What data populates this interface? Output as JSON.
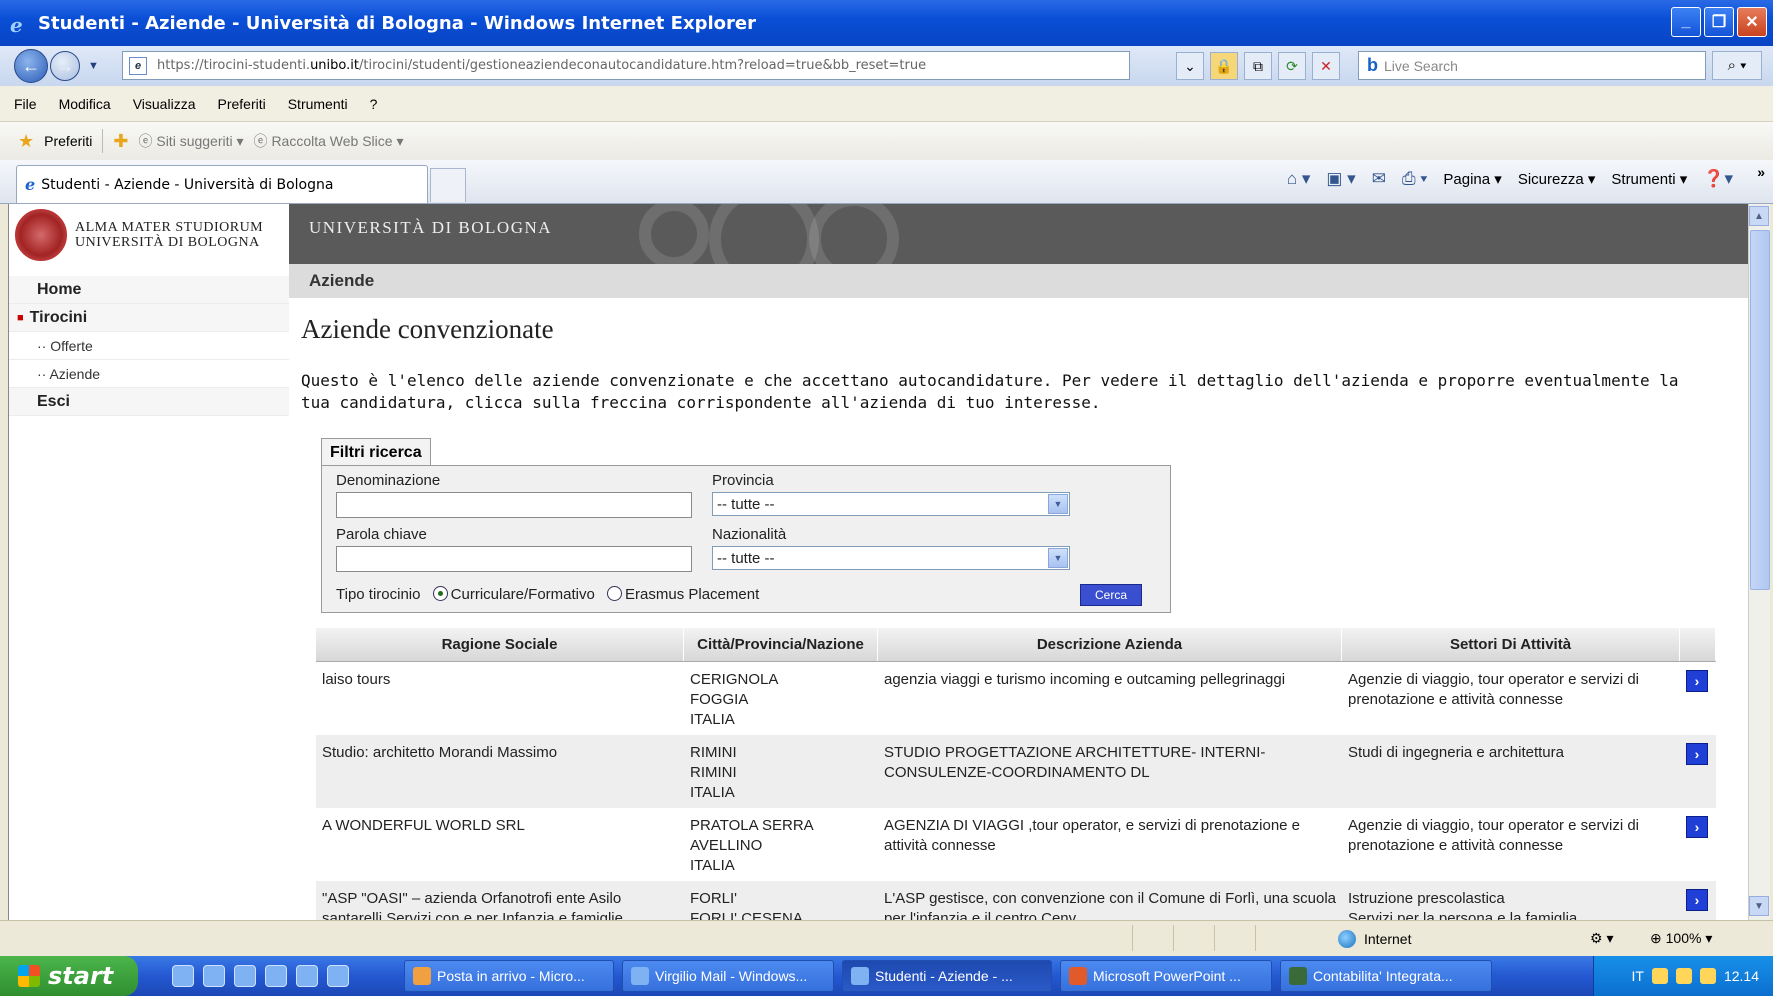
{
  "window": {
    "title": "Studenti - Aziende - Università di Bologna - Windows Internet Explorer"
  },
  "address": {
    "url_prefix": "https://tirocini-studenti.",
    "url_domain": "unibo.it",
    "url_path": "/tirocini/studenti/gestioneaziendeconautocandidature.htm?reload=true&bb_reset=true",
    "search_placeholder": "Live Search"
  },
  "menu": [
    "File",
    "Modifica",
    "Visualizza",
    "Preferiti",
    "Strumenti",
    "?"
  ],
  "favorites": {
    "label": "Preferiti",
    "suggested": "Siti suggeriti",
    "webslice": "Raccolta Web Slice"
  },
  "tab": {
    "title": "Studenti - Aziende - Università di Bologna"
  },
  "commandbar": {
    "pagina": "Pagina",
    "sicurezza": "Sicurezza",
    "strumenti": "Strumenti"
  },
  "site": {
    "logo_line1": "ALMA MATER STUDIORUM",
    "logo_line2": "UNIVERSITÀ DI BOLOGNA",
    "banner_title": "UNIVERSITÀ DI BOLOGNA",
    "section": "Aziende"
  },
  "sidenav": {
    "home": "Home",
    "tirocini": "Tirocini",
    "offerte": "·· Offerte",
    "aziende": "·· Aziende",
    "esci": "Esci"
  },
  "page": {
    "title": "Aziende convenzionate",
    "intro": "Questo è l'elenco delle aziende convenzionate e che accettano autocandidature. Per vedere il dettaglio dell'azienda e proporre eventualmente la tua candidatura, clicca sulla freccina corrispondente all'azienda di tuo interesse."
  },
  "filters": {
    "title": "Filtri ricerca",
    "denominazione_label": "Denominazione",
    "provincia_label": "Provincia",
    "provincia_value": "-- tutte --",
    "parola_label": "Parola chiave",
    "nazionalita_label": "Nazionalità",
    "nazionalita_value": "-- tutte --",
    "tipo_label": "Tipo tirocinio",
    "opt1": "Curriculare/Formativo",
    "opt2": "Erasmus Placement",
    "cerca": "Cerca"
  },
  "table": {
    "headers": [
      "Ragione Sociale",
      "Città/Provincia/Nazione",
      "Descrizione Azienda",
      "Settori Di Attività"
    ],
    "rows": [
      {
        "ragione": "laiso tours",
        "city": "CERIGNOLA",
        "prov": "FOGGIA",
        "naz": "ITALIA",
        "desc": "agenzia viaggi e turismo incoming e outcaming pellegrinaggi",
        "settori": "Agenzie di viaggio, tour operator e servizi di prenotazione e attività connesse"
      },
      {
        "ragione": "Studio: architetto Morandi Massimo",
        "city": "RIMINI",
        "prov": "RIMINI",
        "naz": "ITALIA",
        "desc": "STUDIO PROGETTAZIONE ARCHITETTURE- INTERNI-CONSULENZE-COORDINAMENTO DL",
        "settori": "Studi di ingegneria e architettura"
      },
      {
        "ragione": "A WONDERFUL WORLD SRL",
        "city": "PRATOLA SERRA",
        "prov": "AVELLINO",
        "naz": "ITALIA",
        "desc": "AGENZIA DI VIAGGI ,tour operator, e servizi di prenotazione e attività connesse",
        "settori": "Agenzie di viaggio, tour operator e servizi di prenotazione e attività connesse"
      },
      {
        "ragione": "\"ASP \"OASI\" – azienda Orfanotrofi ente Asilo santarelli Servizi con e per Infanzia e famiglie",
        "city": "FORLI'",
        "prov": "FORLI' CESENA",
        "naz": "",
        "desc": "L'ASP gestisce, con convenzione con il Comune di Forlì, una scuola per l'infanzia e il centro Cenv",
        "settori": "Istruzione prescolastica\nServizi per la persona e la famiglia"
      }
    ]
  },
  "status": {
    "zone": "Internet",
    "zoom": "100%"
  },
  "taskbar": {
    "start": "start",
    "tasks": [
      "Posta in arrivo - Micro...",
      "Virgilio Mail - Windows...",
      "Studenti - Aziende - ...",
      "Microsoft PowerPoint ...",
      "Contabilita' Integrata..."
    ],
    "lang": "IT",
    "clock": "12.14"
  }
}
